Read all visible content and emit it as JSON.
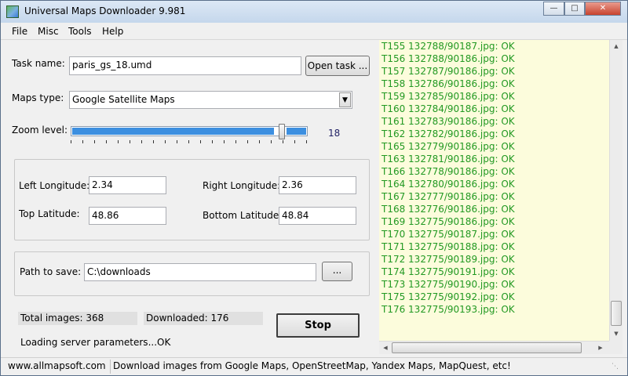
{
  "window": {
    "title": "Universal Maps Downloader 9.981"
  },
  "menu": [
    "File",
    "Misc",
    "Tools",
    "Help"
  ],
  "task": {
    "label": "Task name:",
    "value": "paris_gs_18.umd",
    "open_button": "Open task ..."
  },
  "maps_type": {
    "label": "Maps type:",
    "selected": "Google Satellite Maps"
  },
  "zoom": {
    "label": "Zoom level:",
    "value": "18",
    "level": 18,
    "max": 20
  },
  "coords": {
    "left_lon_label": "Left Longitude:",
    "left_lon": "2.34",
    "right_lon_label": "Right Longitude:",
    "right_lon": "2.36",
    "top_lat_label": "Top Latitude:",
    "top_lat": "48.86",
    "bottom_lat_label": "Bottom Latitude:",
    "bottom_lat": "48.84"
  },
  "save": {
    "label": "Path to save:",
    "value": "C:\\downloads",
    "browse": "..."
  },
  "stats": {
    "total": "Total images: 368",
    "downloaded": "Downloaded: 176"
  },
  "stop_button": "Stop",
  "status_message": "Loading server parameters...OK",
  "log": [
    "T155 132788/90187.jpg: OK",
    "T156 132788/90186.jpg: OK",
    "T157 132787/90186.jpg: OK",
    "T158 132786/90186.jpg: OK",
    "T159 132785/90186.jpg: OK",
    "T160 132784/90186.jpg: OK",
    "T161 132783/90186.jpg: OK",
    "T162 132782/90186.jpg: OK",
    "T165 132779/90186.jpg: OK",
    "T163 132781/90186.jpg: OK",
    "T166 132778/90186.jpg: OK",
    "T164 132780/90186.jpg: OK",
    "T167 132777/90186.jpg: OK",
    "T168 132776/90186.jpg: OK",
    "T169 132775/90186.jpg: OK",
    "T170 132775/90187.jpg: OK",
    "T171 132775/90188.jpg: OK",
    "T172 132775/90189.jpg: OK",
    "T174 132775/90191.jpg: OK",
    "T173 132775/90190.jpg: OK",
    "T175 132775/90192.jpg: OK",
    "T176 132775/90193.jpg: OK"
  ],
  "statusbar": {
    "url": "www.allmapsoft.com",
    "message": "Download images from Google Maps, OpenStreetMap, Yandex Maps, MapQuest, etc!"
  },
  "colors": {
    "log_text": "#229922",
    "log_bg": "#fcfcdc",
    "slider_fill": "#3c8fe0"
  }
}
